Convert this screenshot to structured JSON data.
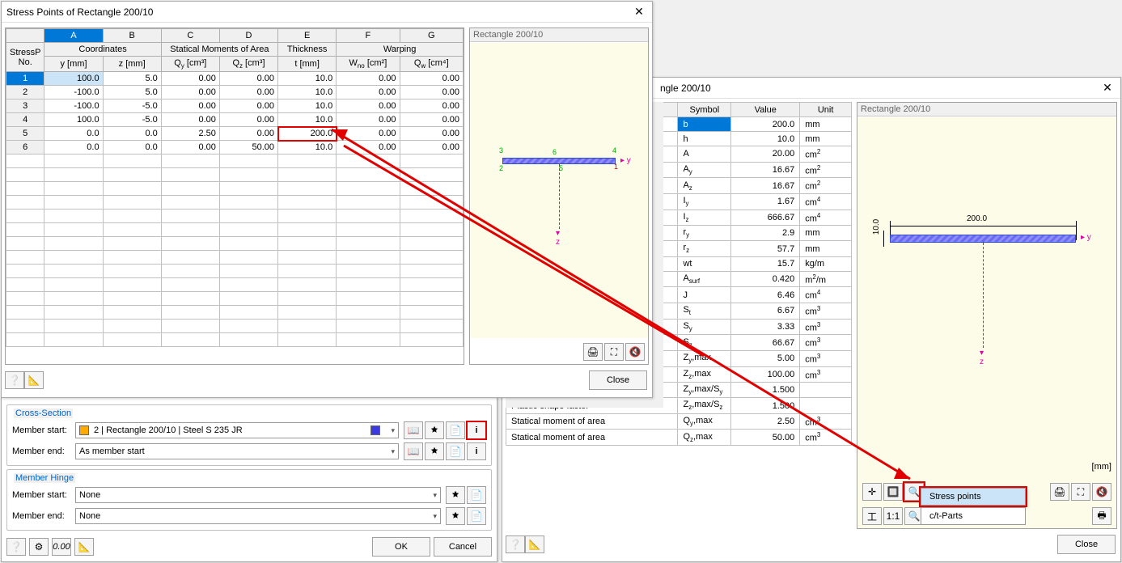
{
  "dialog1": {
    "title": "Stress Points of Rectangle 200/10",
    "preview_label": "Rectangle 200/10",
    "close": "Close",
    "columns": [
      "A",
      "B",
      "C",
      "D",
      "E",
      "F",
      "G"
    ],
    "group_headers": {
      "rownum": "StressP\nNo.",
      "coords": "Coordinates",
      "stat": "Statical Moments of Area",
      "thick": "Thickness",
      "warp": "Warping"
    },
    "sub_headers": [
      "y [mm]",
      "z [mm]",
      "Q_y [cm³]",
      "Q_z [cm³]",
      "t [mm]",
      "W_no [cm²]",
      "Q_w [cm⁴]"
    ],
    "rows": [
      [
        "1",
        "100.0",
        "5.0",
        "0.00",
        "0.00",
        "10.0",
        "0.00",
        "0.00"
      ],
      [
        "2",
        "-100.0",
        "5.0",
        "0.00",
        "0.00",
        "10.0",
        "0.00",
        "0.00"
      ],
      [
        "3",
        "-100.0",
        "-5.0",
        "0.00",
        "0.00",
        "10.0",
        "0.00",
        "0.00"
      ],
      [
        "4",
        "100.0",
        "-5.0",
        "0.00",
        "0.00",
        "10.0",
        "0.00",
        "0.00"
      ],
      [
        "5",
        "0.0",
        "0.0",
        "2.50",
        "0.00",
        "200.0",
        "0.00",
        "0.00"
      ],
      [
        "6",
        "0.0",
        "0.0",
        "0.00",
        "50.00",
        "10.0",
        "0.00",
        "0.00"
      ]
    ]
  },
  "dialog2": {
    "title_frag": "ngle 200/10",
    "preview_label": "Rectangle 200/10",
    "close": "Close",
    "headers": {
      "symbol": "Symbol",
      "value": "Value",
      "unit": "Unit"
    },
    "rows": [
      {
        "sym": "b",
        "val": "200.0",
        "unit": "mm",
        "sel": true
      },
      {
        "sym": "h",
        "val": "10.0",
        "unit": "mm"
      },
      {
        "sym": "A",
        "val": "20.00",
        "unit": "cm²"
      },
      {
        "sym": "A_y",
        "val": "16.67",
        "unit": "cm²"
      },
      {
        "sym": "A_z",
        "val": "16.67",
        "unit": "cm²"
      },
      {
        "sym": "I_y",
        "val": "1.67",
        "unit": "cm⁴"
      },
      {
        "sym": "I_z",
        "val": "666.67",
        "unit": "cm⁴"
      },
      {
        "sym": "r_y",
        "val": "2.9",
        "unit": "mm"
      },
      {
        "sym": "r_z",
        "val": "57.7",
        "unit": "mm"
      },
      {
        "sym": "wt",
        "val": "15.7",
        "unit": "kg/m"
      },
      {
        "sym": "A_surf",
        "val": "0.420",
        "unit": "m²/m"
      },
      {
        "sym": "J",
        "val": "6.46",
        "unit": "cm⁴"
      },
      {
        "sym": "S_t",
        "val": "6.67",
        "unit": "cm³"
      },
      {
        "sym": "S_y",
        "val": "3.33",
        "unit": "cm³"
      },
      {
        "sym": "S_z",
        "val": "66.67",
        "unit": "cm³"
      },
      {
        "sym": "Z_y,max",
        "val": "5.00",
        "unit": "cm³"
      },
      {
        "sym": "Z_z,max",
        "val": "100.00",
        "unit": "cm³"
      },
      {
        "sym": "Z_y,max/S_y",
        "val": "1.500",
        "unit": ""
      },
      {
        "sym": "Z_z,max/S_z",
        "val": "1.500",
        "unit": ""
      },
      {
        "sym": "Q_y,max",
        "val": "2.50",
        "unit": "cm³"
      },
      {
        "sym": "Q_z,max",
        "val": "50.00",
        "unit": "cm³"
      }
    ],
    "desc": {
      "psf": "Plastic shape factor",
      "psf2": "Plastic shape factor",
      "sma": "Statical moment of area",
      "sma2": "Statical moment of area"
    },
    "menu": {
      "stresspoints": "Stress points",
      "ctparts": "c/t-Parts"
    },
    "dim_w": "200.0",
    "dim_h": "10.0",
    "mm": "[mm]"
  },
  "dialog3": {
    "legend_cs": "Cross-Section",
    "legend_mh": "Member Hinge",
    "labels": {
      "start": "Member start:",
      "end": "Member end:"
    },
    "cs_start": "2 | Rectangle 200/10 | Steel S 235 JR",
    "cs_end": "As member start",
    "hinge_start": "None",
    "hinge_end": "None",
    "ok": "OK",
    "cancel": "Cancel"
  }
}
